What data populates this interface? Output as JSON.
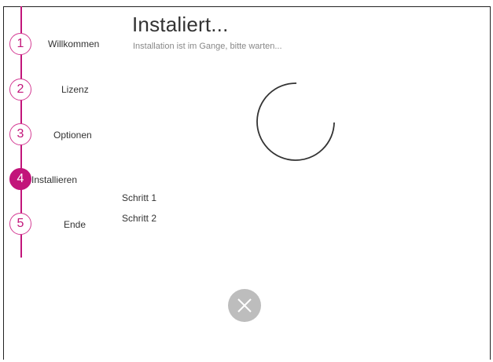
{
  "header": {
    "title": "Instaliert...",
    "subtitle": "Installation ist im Gange, bitte warten..."
  },
  "steps": [
    {
      "number": "1",
      "label": "Willkommen",
      "active": false
    },
    {
      "number": "2",
      "label": "Lizenz",
      "active": false
    },
    {
      "number": "3",
      "label": "Optionen",
      "active": false
    },
    {
      "number": "4",
      "label": "Installieren",
      "active": true
    },
    {
      "number": "5",
      "label": "Ende",
      "active": false
    }
  ],
  "substeps": [
    "Schritt 1",
    "Schritt 2"
  ],
  "cancel": {
    "icon": "close-icon"
  },
  "colors": {
    "accent": "#c2157a",
    "cancel_bg": "#bdbdbd",
    "spinner": "#333333"
  }
}
